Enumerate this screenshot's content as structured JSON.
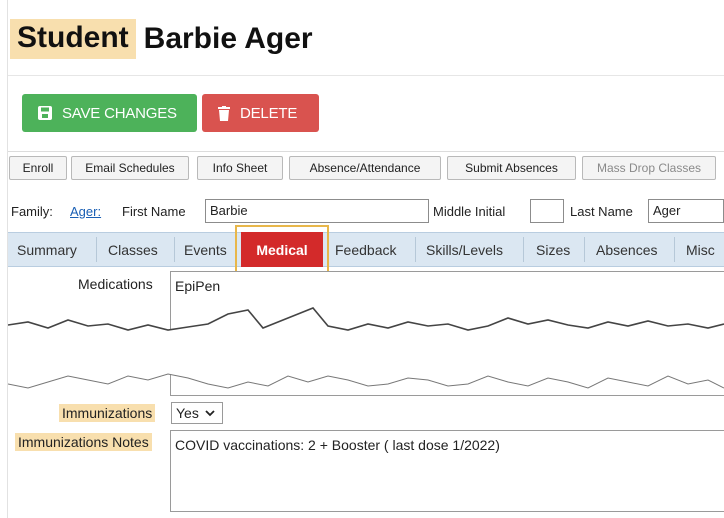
{
  "header": {
    "title_word": "Student",
    "title_name": "Barbie Ager"
  },
  "actions": {
    "save_label": "SAVE CHANGES",
    "delete_label": "DELETE"
  },
  "toolbar": {
    "enroll": "Enroll",
    "email_schedules": "Email Schedules",
    "info_sheet": "Info Sheet",
    "absence_attendance": "Absence/Attendance",
    "submit_absences": "Submit Absences",
    "mass_drop_classes": "Mass Drop Classes"
  },
  "name_row": {
    "family_label": "Family:",
    "family_link": "Ager:",
    "first_name_label": "First Name",
    "first_name_value": "Barbie",
    "middle_initial_label": "Middle Initial",
    "middle_initial_value": "",
    "last_name_label": "Last Name",
    "last_name_value": "Ager"
  },
  "tabs": {
    "summary": "Summary",
    "classes": "Classes",
    "events": "Events",
    "medical": "Medical",
    "feedback": "Feedback",
    "skills_levels": "Skills/Levels",
    "sizes": "Sizes",
    "absences": "Absences",
    "misc": "Misc"
  },
  "medical": {
    "medications_label": "Medications",
    "medications_value": "EpiPen",
    "immunizations_label": "Immunizations",
    "immunizations_value": "Yes",
    "immunizations_notes_label": "Immunizations Notes",
    "immunizations_notes_value": "COVID vaccinations: 2 + Booster ( last dose 1/2022)"
  },
  "colors": {
    "save": "#4db25a",
    "delete": "#d9534f",
    "active_tab": "#d32a2a",
    "highlight": "#f8dfae",
    "tab_bar": "#dbe7f2"
  }
}
